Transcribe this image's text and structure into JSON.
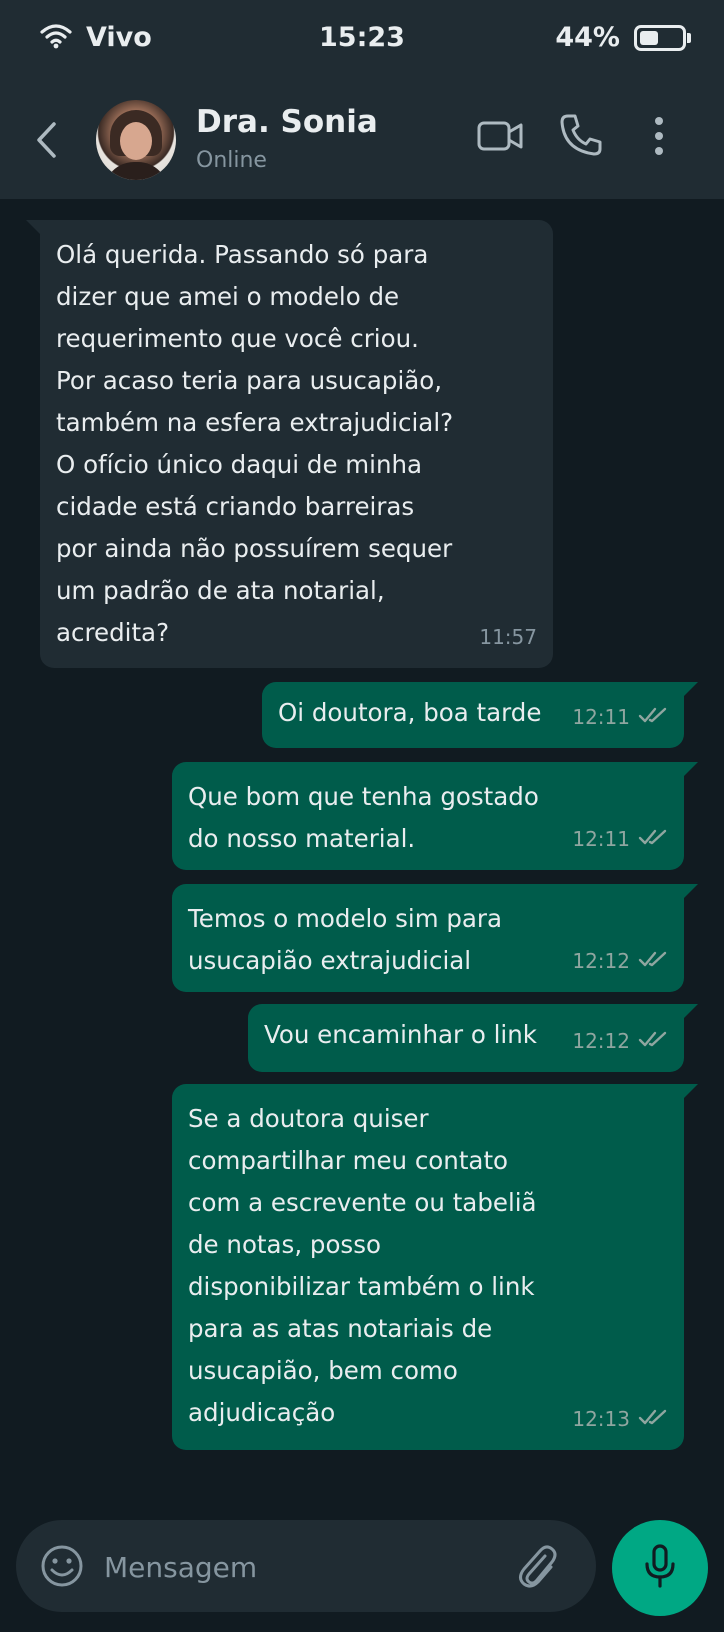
{
  "status_bar": {
    "carrier": "Vivo",
    "time": "15:23",
    "battery": "44%",
    "battery_level": 0.44,
    "icons": [
      "wifi-icon",
      "battery-icon"
    ]
  },
  "header": {
    "contact_name": "Dra. Sonia",
    "contact_status": "Online",
    "icons": [
      "back-arrow-icon",
      "video-call-icon",
      "phone-icon",
      "more-vertical-icon"
    ]
  },
  "messages": [
    {
      "direction": "incoming",
      "text": "Olá querida. Passando só para\ndizer que amei o modelo de\nrequerimento que você criou.\nPor acaso teria para usucapião,\ntambém na esfera extrajudicial?\nO ofício único daqui de minha\ncidade está criando barreiras\npor ainda não possuírem sequer\num padrão de ata notarial,\nacredita?",
      "time": "11:57"
    },
    {
      "direction": "outgoing",
      "text": "Oi doutora, boa tarde",
      "time": "12:11",
      "read": true
    },
    {
      "direction": "outgoing",
      "text": "Que bom que tenha gostado\ndo nosso material.",
      "time": "12:11",
      "read": true
    },
    {
      "direction": "outgoing",
      "text": "Temos o modelo sim para\nusucapião extrajudicial",
      "time": "12:12",
      "read": true
    },
    {
      "direction": "outgoing",
      "text": "Vou encaminhar o link",
      "time": "12:12",
      "read": true
    },
    {
      "direction": "outgoing",
      "text": "Se a doutora quiser\ncompartilhar meu contato\ncom a escrevente ou tabeliã\nde notas, posso\ndisponibilizar também o link\npara as atas notariais de\nusucapião, bem como\nadjudicação",
      "time": "12:13",
      "read": true
    }
  ],
  "composer": {
    "placeholder": "Mensagem",
    "icons": [
      "emoji-icon",
      "attach-icon",
      "mic-icon"
    ]
  },
  "colors": {
    "background": "#111b21",
    "bar": "#202c33",
    "incoming_bubble": "#202c33",
    "outgoing_bubble": "#005c4b",
    "accent": "#00a884"
  }
}
